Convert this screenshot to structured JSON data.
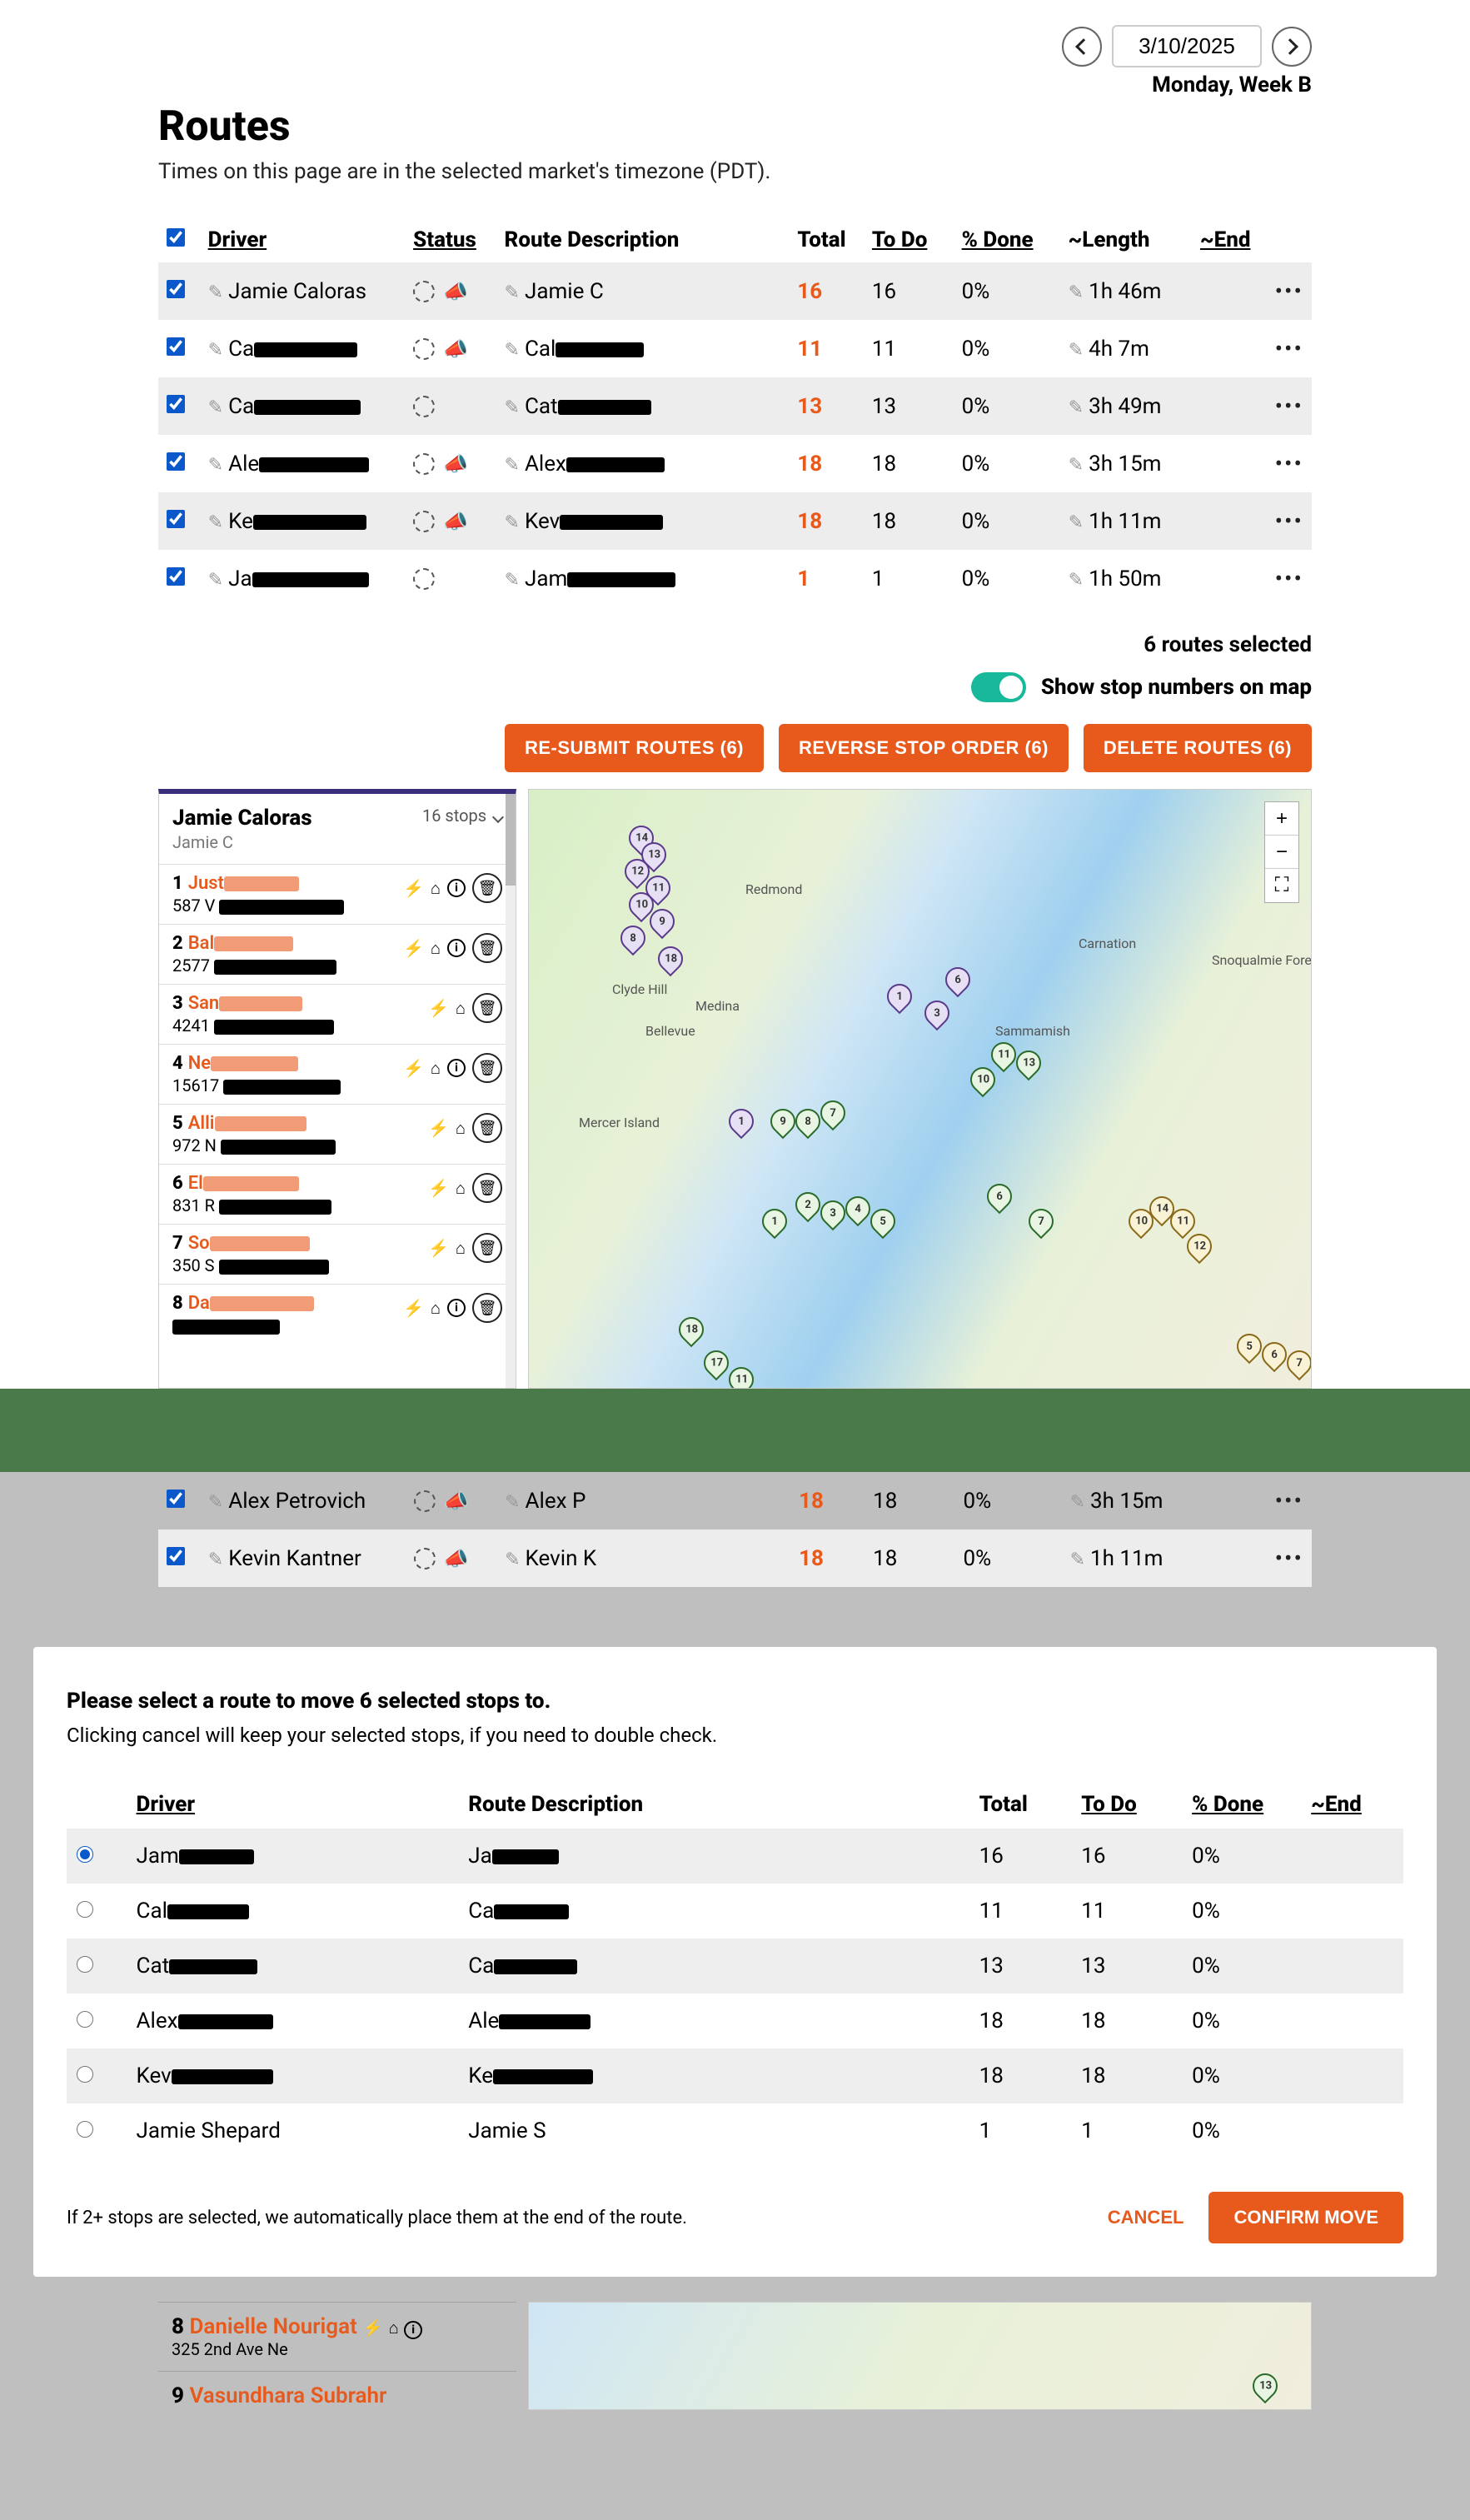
{
  "header": {
    "date": "3/10/2025",
    "day_label": "Monday, Week B",
    "title": "Routes",
    "subtitle": "Times on this page are in the selected market's timezone (PDT)."
  },
  "columns": {
    "driver": "Driver",
    "status": "Status",
    "route_desc": "Route Description",
    "total": "Total",
    "todo": "To Do",
    "pct_done": "% Done",
    "length": "~Length",
    "end": "~End"
  },
  "routes": [
    {
      "driver": "Jamie Caloras",
      "desc": "Jamie C",
      "total": "16",
      "todo": "16",
      "pct": "0%",
      "length": "1h 46m",
      "megaphone": true
    },
    {
      "driver": "Ca",
      "desc": "Cal",
      "total": "11",
      "todo": "11",
      "pct": "0%",
      "length": "4h 7m",
      "megaphone": true
    },
    {
      "driver": "Ca",
      "desc": "Cat",
      "total": "13",
      "todo": "13",
      "pct": "0%",
      "length": "3h 49m",
      "megaphone": false
    },
    {
      "driver": "Ale",
      "desc": "Alex",
      "total": "18",
      "todo": "18",
      "pct": "0%",
      "length": "3h 15m",
      "megaphone": true
    },
    {
      "driver": "Ke",
      "desc": "Kev",
      "total": "18",
      "todo": "18",
      "pct": "0%",
      "length": "1h 11m",
      "megaphone": true
    },
    {
      "driver": "Ja",
      "desc": "Jam",
      "total": "1",
      "todo": "1",
      "pct": "0%",
      "length": "1h 50m",
      "megaphone": false
    }
  ],
  "selected_summary": "6 routes selected",
  "toggle_label": "Show stop numbers on map",
  "buttons": {
    "resubmit": "RE-SUBMIT ROUTES (6)",
    "reverse": "REVERSE STOP ORDER (6)",
    "delete": "DELETE ROUTES (6)"
  },
  "stops_panel": {
    "driver": "Jamie Caloras",
    "desc": "Jamie C",
    "count_label": "16 stops",
    "items": [
      {
        "idx": "1",
        "name": "Just",
        "addr_prefix": "587 V",
        "info": true
      },
      {
        "idx": "2",
        "name": "Bal",
        "addr_prefix": "2577",
        "info": true
      },
      {
        "idx": "3",
        "name": "San",
        "addr_prefix": "4241",
        "info": false
      },
      {
        "idx": "4",
        "name": "Ne",
        "addr_prefix": "15617",
        "info": true
      },
      {
        "idx": "5",
        "name": "Alli",
        "addr_prefix": "972 N",
        "info": false
      },
      {
        "idx": "6",
        "name": "El",
        "addr_prefix": "831 R",
        "info": false
      },
      {
        "idx": "7",
        "name": "So",
        "addr_prefix": "350 S",
        "info": false
      },
      {
        "idx": "8",
        "name": "Da",
        "addr_prefix": "",
        "info": true
      }
    ]
  },
  "map": {
    "zoom_in": "+",
    "zoom_out": "−",
    "fullscreen": "⛶",
    "labels": [
      "Redmond",
      "Bellevue",
      "Sammamish",
      "Mercer Island",
      "Clyde Hill",
      "Medina",
      "Snoqualmie Forest",
      "Carnation"
    ]
  },
  "dimmed_rows": [
    {
      "driver": "Alex Petrovich",
      "desc": "Alex P",
      "total": "18",
      "todo": "18",
      "pct": "0%",
      "length": "3h 15m",
      "megaphone": true
    },
    {
      "driver": "Kevin Kantner",
      "desc": "Kevin K",
      "total": "18",
      "todo": "18",
      "pct": "0%",
      "length": "1h 11m",
      "megaphone": true
    }
  ],
  "modal": {
    "title": "Please select a route to move 6 selected stops to.",
    "subtitle": "Clicking cancel will keep your selected stops, if you need to double check.",
    "columns": {
      "driver": "Driver",
      "desc": "Route Description",
      "total": "Total",
      "todo": "To Do",
      "pct": "% Done",
      "end": "~End"
    },
    "rows": [
      {
        "driver": "Jam",
        "desc": "Ja",
        "total": "16",
        "todo": "16",
        "pct": "0%"
      },
      {
        "driver": "Cal",
        "desc": "Ca",
        "total": "11",
        "todo": "11",
        "pct": "0%"
      },
      {
        "driver": "Cat",
        "desc": "Ca",
        "total": "13",
        "todo": "13",
        "pct": "0%"
      },
      {
        "driver": "Alex",
        "desc": "Ale",
        "total": "18",
        "todo": "18",
        "pct": "0%"
      },
      {
        "driver": "Kev",
        "desc": "Ke",
        "total": "18",
        "todo": "18",
        "pct": "0%"
      },
      {
        "driver": "Jamie Shepard",
        "desc": "Jamie S",
        "total": "1",
        "todo": "1",
        "pct": "0%"
      }
    ],
    "note": "If 2+ stops are selected, we automatically place them at the end of the route.",
    "cancel": "CANCEL",
    "confirm": "CONFIRM MOVE"
  },
  "below_modal": {
    "stop": {
      "idx": "8",
      "name": "Danielle Nourigat",
      "addr": "325 2nd Ave Ne"
    },
    "next": {
      "idx": "9",
      "name": "Vasundhara Subrahr"
    }
  }
}
